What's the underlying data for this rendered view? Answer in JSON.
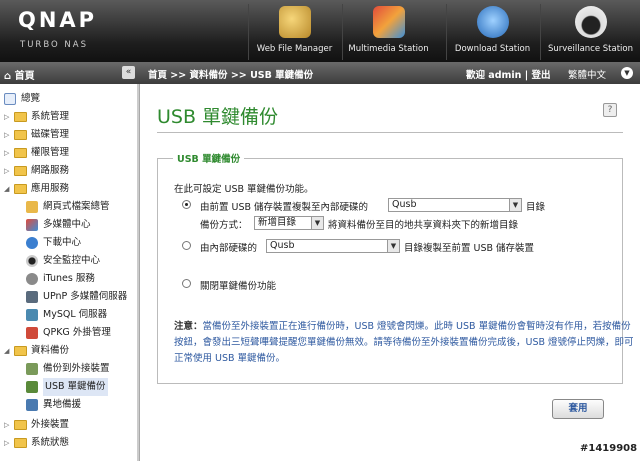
{
  "header": {
    "logo": "QNAP",
    "sublogo": "TURBO NAS",
    "stations": [
      {
        "label": "Web File Manager",
        "icon": "web-file-manager-icon"
      },
      {
        "label": "Multimedia Station",
        "icon": "multimedia-station-icon"
      },
      {
        "label": "Download Station",
        "icon": "download-station-icon"
      },
      {
        "label": "Surveillance Station",
        "icon": "surveillance-station-icon"
      }
    ]
  },
  "bar": {
    "home": "首頁",
    "collapse": "«",
    "breadcrumb": "首頁 >> 資料備份 >> USB 單鍵備份",
    "welcome": "歡迎 admin | 登出",
    "language": "繁體中文"
  },
  "sidebar": {
    "items": [
      {
        "label": "總覽"
      },
      {
        "label": "系統管理"
      },
      {
        "label": "磁碟管理"
      },
      {
        "label": "權限管理"
      },
      {
        "label": "網路服務"
      },
      {
        "label": "應用服務"
      },
      {
        "label": "網頁式檔案總管"
      },
      {
        "label": "多媒體中心"
      },
      {
        "label": "下載中心"
      },
      {
        "label": "安全監控中心"
      },
      {
        "label": "iTunes 服務"
      },
      {
        "label": "UPnP 多媒體伺服器"
      },
      {
        "label": "MySQL 伺服器"
      },
      {
        "label": "QPKG 外掛管理"
      },
      {
        "label": "資料備份"
      },
      {
        "label": "備份到外接裝置"
      },
      {
        "label": "USB 單鍵備份"
      },
      {
        "label": "異地備援"
      },
      {
        "label": "外接裝置"
      },
      {
        "label": "系統狀態"
      }
    ]
  },
  "main": {
    "title": "USB 單鍵備份",
    "group_title": "USB 單鍵備份",
    "description": "在此可設定 USB 單鍵備份功能。",
    "option1": {
      "prefix": "由前置 USB 儲存裝置複製至內部硬碟的",
      "select_value": "Qusb",
      "suffix": "目錄",
      "mode_label": "備份方式：",
      "mode_value": "新增目錄",
      "mode_desc": "將資料備份至目的地共享資料夾下的新增目錄"
    },
    "option2": {
      "prefix": "由內部硬碟的",
      "select_value": "Qusb",
      "suffix": "目錄複製至前置 USB 儲存裝置"
    },
    "option3": {
      "label": "關閉單鍵備份功能"
    },
    "note_label": "注意：",
    "note_text": "當備份至外接裝置正在進行備份時，USB 燈號會閃爍。此時 USB 單鍵備份會暫時沒有作用，若按備份按鈕，會發出三短聲嗶聲提醒您單鍵備份無效。請等待備份至外接裝置備份完成後，USB 燈號停止閃爍，即可正常使用 USB 單鍵備份。",
    "apply": "套用"
  },
  "watermark": "#1419908"
}
